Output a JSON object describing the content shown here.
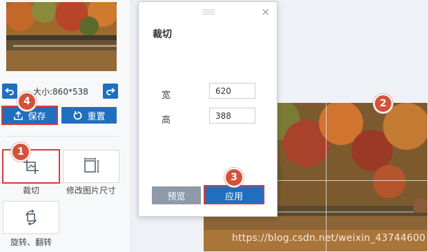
{
  "sidebar": {
    "image_size_text": "大小:860*538",
    "save_label": "保存",
    "reset_label": "重置",
    "tools": [
      {
        "label": "裁切"
      },
      {
        "label": "修改图片尺寸"
      },
      {
        "label": "旋转、翻转"
      }
    ]
  },
  "dialog": {
    "title": "裁切",
    "close_symbol": "×",
    "width_label": "宽",
    "width_value": "620",
    "height_label": "高",
    "height_value": "388",
    "preview_label": "预览",
    "apply_label": "应用"
  },
  "badges": [
    "1",
    "2",
    "3",
    "4"
  ],
  "watermark": "https://blog.csdn.net/weixin_43744600",
  "colors": {
    "primary": "#1f6fbf",
    "badge": "#d2533c",
    "highlight": "#d63a3a",
    "preview_button": "#8e9aa8"
  }
}
